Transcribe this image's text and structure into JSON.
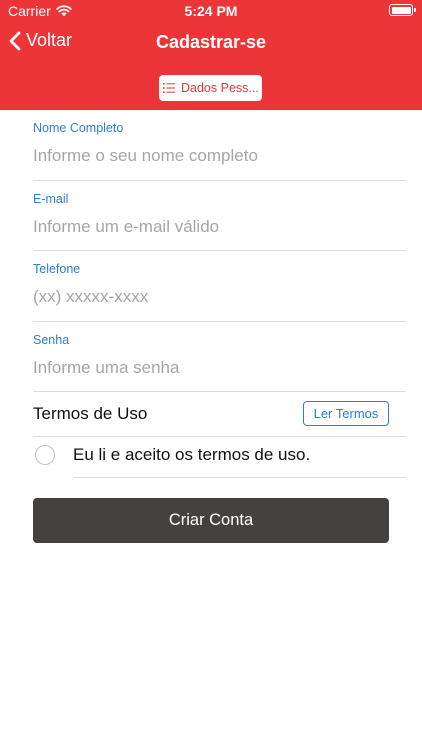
{
  "status_bar": {
    "carrier": "Carrier",
    "time": "5:24 PM"
  },
  "nav": {
    "back_label": "Voltar",
    "title": "Cadastrar-se"
  },
  "segment": {
    "label": "Dados Pess..."
  },
  "form": {
    "fields": [
      {
        "label": "Nome Completo",
        "placeholder": "Informe o seu nome completo",
        "value": ""
      },
      {
        "label": "E-mail",
        "placeholder": "Informe um e-mail válido",
        "value": ""
      },
      {
        "label": "Telefone",
        "placeholder": "(xx) xxxxx-xxxx",
        "value": ""
      },
      {
        "label": "Senha",
        "placeholder": "Informe uma senha",
        "value": ""
      }
    ],
    "terms_label": "Termos de Uso",
    "terms_button": "Ler Termos",
    "agree_text": "Eu li e aceito os termos de uso.",
    "agree_checked": false
  },
  "submit": {
    "label": "Criar Conta"
  },
  "colors": {
    "primary": "#eb3538",
    "link": "#2f7fcf",
    "button": "#444240"
  }
}
